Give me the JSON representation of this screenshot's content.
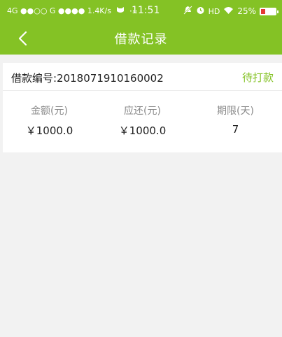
{
  "status_bar": {
    "left_text": "4G ●●○○ G ●●●● 1.4K/s",
    "more": "···",
    "time": "11:51",
    "hd": "HD",
    "battery_percent": "25%",
    "battery_level": 0.25,
    "battery_color": "#e53935"
  },
  "nav": {
    "title": "借款记录",
    "back_icon": "chevron-left-icon"
  },
  "loan": {
    "number_label": "借款编号:2018071910160002",
    "status": "待打款",
    "stats": [
      {
        "label": "金额(元)",
        "value": "￥1000.0"
      },
      {
        "label": "应还(元)",
        "value": "￥1000.0"
      },
      {
        "label": "期限(天)",
        "value": "7"
      }
    ]
  },
  "colors": {
    "brand_green": "#84c225",
    "page_bg": "#f2f2f2"
  }
}
